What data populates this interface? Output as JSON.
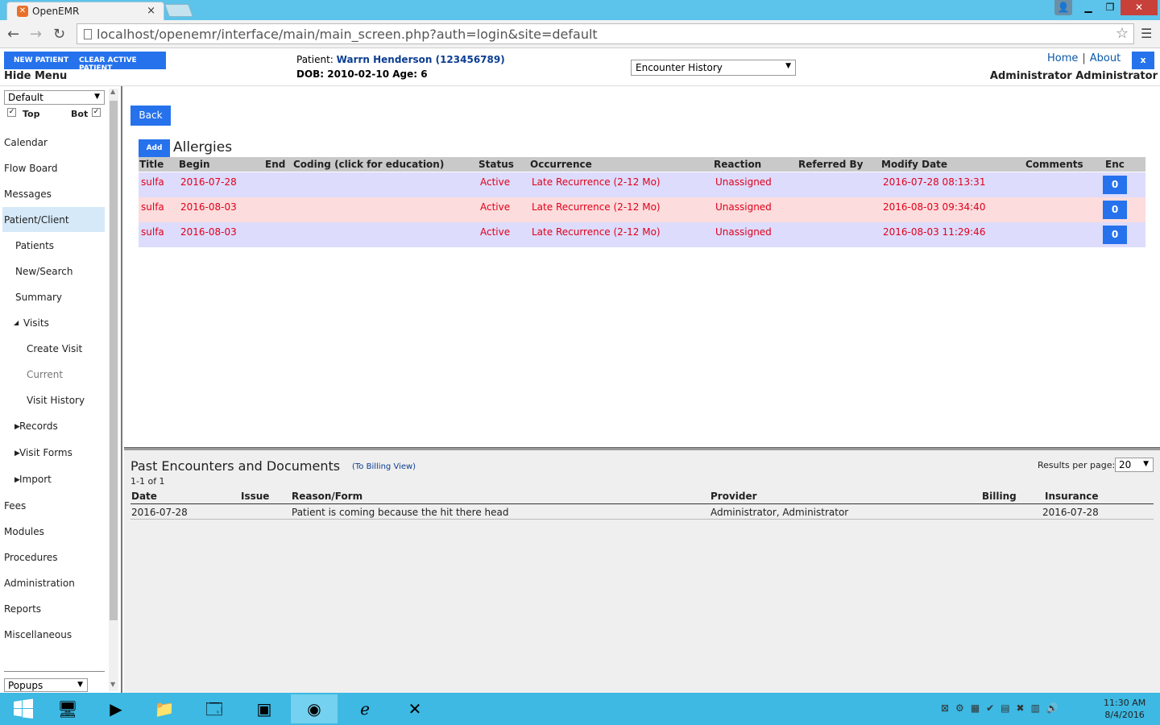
{
  "browser": {
    "tab_title": "OpenEMR",
    "tab_close": "×",
    "url": "localhost/openemr/interface/main/main_screen.php?auth=login&site=default"
  },
  "header": {
    "new_patient": "NEW PATIENT",
    "clear_active_patient": "CLEAR ACTIVE PATIENT",
    "hide_menu": "Hide Menu",
    "patient_label": "Patient:",
    "patient_name": "Warrn Henderson (123456789)",
    "dob_line": "DOB: 2010-02-10 Age: 6",
    "encounter_select": "Encounter History",
    "home": "Home",
    "separator": "|",
    "about": "About",
    "close": "x",
    "user": "Administrator Administrator"
  },
  "sidebar": {
    "default_select": "Default",
    "top_label": "Top",
    "bot_label": "Bot",
    "items": {
      "calendar": "Calendar",
      "flow_board": "Flow Board",
      "messages": "Messages",
      "patient_client": "Patient/Client",
      "patients": "Patients",
      "new_search": "New/Search",
      "summary": "Summary",
      "visits": "Visits",
      "create_visit": "Create Visit",
      "current": "Current",
      "visit_history": "Visit History",
      "records": "Records",
      "visit_forms": "Visit Forms",
      "import": "Import",
      "fees": "Fees",
      "modules": "Modules",
      "procedures": "Procedures",
      "administration": "Administration",
      "reports": "Reports",
      "miscellaneous": "Miscellaneous"
    },
    "popups_select": "Popups"
  },
  "main": {
    "back": "Back",
    "add": "Add",
    "section_title": "Allergies",
    "columns": {
      "title": "Title",
      "begin": "Begin",
      "end": "End",
      "coding": "Coding (click for education)",
      "status": "Status",
      "occurrence": "Occurrence",
      "reaction": "Reaction",
      "referred_by": "Referred By",
      "modify_date": "Modify Date",
      "comments": "Comments",
      "enc": "Enc"
    },
    "rows": [
      {
        "title": "sulfa",
        "begin": "2016-07-28",
        "status": "Active",
        "occurrence": "Late Recurrence (2-12 Mo)",
        "reaction": "Unassigned",
        "modify_date": "2016-07-28 08:13:31",
        "enc": "0"
      },
      {
        "title": "sulfa",
        "begin": "2016-08-03",
        "status": "Active",
        "occurrence": "Late Recurrence (2-12 Mo)",
        "reaction": "Unassigned",
        "modify_date": "2016-08-03 09:34:40",
        "enc": "0"
      },
      {
        "title": "sulfa",
        "begin": "2016-08-03",
        "status": "Active",
        "occurrence": "Late Recurrence (2-12 Mo)",
        "reaction": "Unassigned",
        "modify_date": "2016-08-03 11:29:46",
        "enc": "0"
      }
    ]
  },
  "encounters": {
    "title": "Past Encounters and Documents",
    "billing_view": "(To Billing View)",
    "count": "1-1 of 1",
    "results_per_page_label": "Results per page:",
    "results_per_page": "20",
    "columns": {
      "date": "Date",
      "issue": "Issue",
      "reason": "Reason/Form",
      "provider": "Provider",
      "billing": "Billing",
      "insurance": "Insurance"
    },
    "rows": [
      {
        "date": "2016-07-28",
        "issue": "",
        "reason": "Patient is coming because the hit there head",
        "provider": "Administrator, Administrator",
        "billing": "",
        "insurance": "2016-07-28"
      }
    ]
  },
  "taskbar": {
    "time": "11:30 AM",
    "date": "8/4/2016"
  },
  "colors": {
    "accent": "#2672ec",
    "alert_text": "#e0001b",
    "row_blue": "#dddcfc",
    "row_pink": "#fcdcdc",
    "taskbar": "#3db9e3"
  }
}
